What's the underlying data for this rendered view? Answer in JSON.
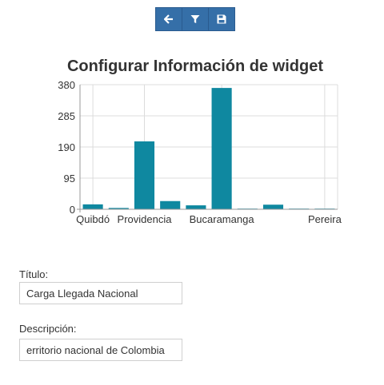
{
  "toolbar": {
    "buttons": [
      {
        "icon": "arrow-left-icon"
      },
      {
        "icon": "filter-icon"
      },
      {
        "icon": "save-icon"
      }
    ],
    "color": "#356fa8"
  },
  "chart_data": {
    "type": "bar",
    "title": "Configurar Información de widget",
    "categories": [
      "Quibdó",
      "",
      "Providencia",
      "",
      "",
      "Bucaramanga",
      "",
      "",
      "",
      "Pereira"
    ],
    "values": [
      15,
      4,
      207,
      25,
      12,
      370,
      2,
      14,
      2,
      2
    ],
    "x_tick_labels": [
      "Quibdó",
      "Providencia",
      "Bucaramanga",
      "Pereira"
    ],
    "y_ticks": [
      0,
      95,
      190,
      285,
      380
    ],
    "ylim": [
      0,
      380
    ],
    "bar_color": "#0f88a0",
    "grid": true
  },
  "form": {
    "title_label": "Título:",
    "title_value": "Carga Llegada Nacional",
    "description_label": "Descripción:",
    "description_value": "erritorio nacional de Colombia"
  }
}
